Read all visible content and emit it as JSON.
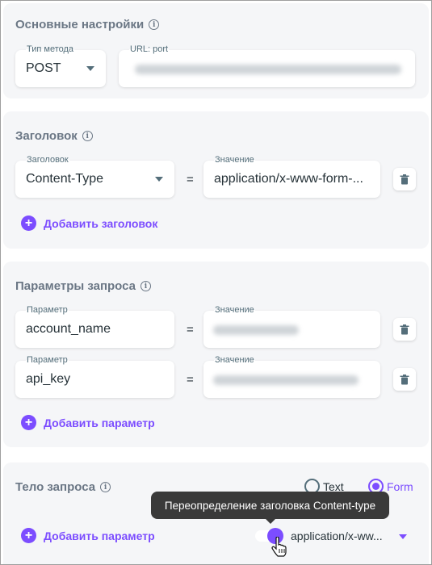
{
  "basic": {
    "title": "Основные настройки",
    "method_label": "Тип метода",
    "method_value": "POST",
    "url_label": "URL: port"
  },
  "headers": {
    "title": "Заголовок",
    "header_label": "Заголовок",
    "header_value": "Content-Type",
    "equals": "=",
    "value_label": "Значение",
    "value_value": "application/x-www-form-...",
    "add_label": "Добавить заголовок"
  },
  "params": {
    "title": "Параметры запроса",
    "rows": [
      {
        "param_label": "Параметр",
        "param_value": "account_name",
        "equals": "=",
        "value_label": "Значение"
      },
      {
        "param_label": "Параметр",
        "param_value": "api_key",
        "equals": "=",
        "value_label": "Значение"
      }
    ],
    "add_label": "Добавить параметр"
  },
  "body": {
    "title": "Тело запроса",
    "radio_text": "Text",
    "radio_form": "Form",
    "selected": "Form",
    "add_label": "Добавить параметр",
    "tooltip": "Переопределение заголовка Content-type",
    "content_type": "application/x-ww...",
    "override_on": true
  },
  "icons": {
    "info": "info-icon",
    "trash": "trash-icon",
    "plus": "plus-icon",
    "caret": "chevron-down-icon",
    "cursor": "hand-pointer-icon"
  },
  "colors": {
    "accent": "#7c4dff",
    "card": "#f5f6f8",
    "title": "#6b7785",
    "tooltip": "#3a3a3a"
  }
}
